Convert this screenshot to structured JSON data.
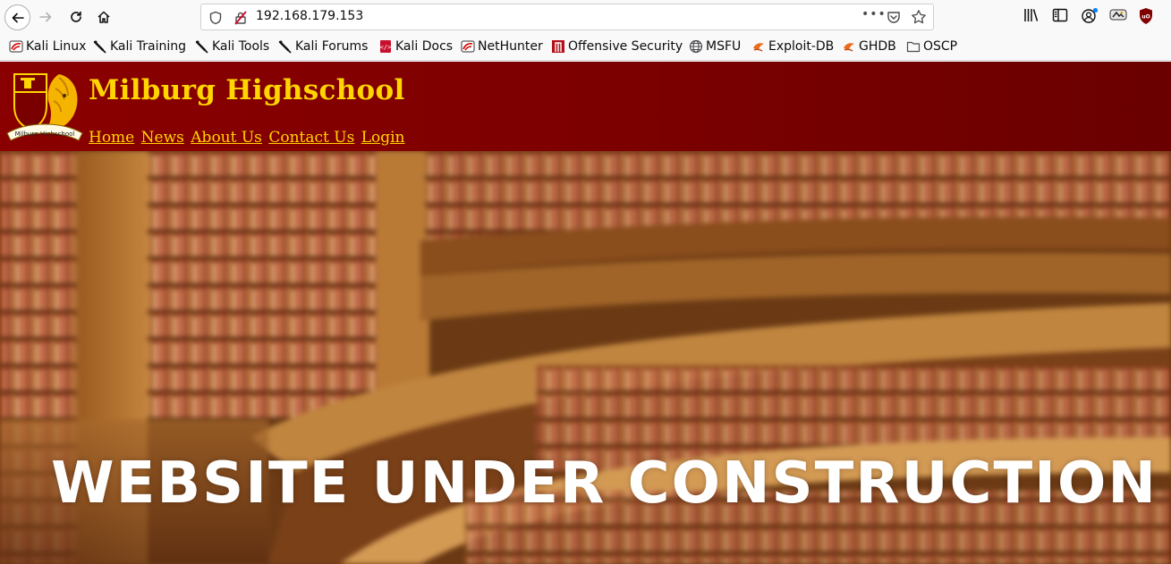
{
  "browser": {
    "url": "192.168.179.153",
    "url_actions_glyph": "•••",
    "bookmarks": [
      {
        "label": "Kali Linux",
        "icon": "kali-dragon-icon"
      },
      {
        "label": "Kali Training",
        "icon": "kali-sword-icon"
      },
      {
        "label": "Kali Tools",
        "icon": "kali-sword-icon"
      },
      {
        "label": "Kali Forums",
        "icon": "kali-sword-icon"
      },
      {
        "label": "Kali Docs",
        "icon": "docs-icon"
      },
      {
        "label": "NetHunter",
        "icon": "kali-dragon-icon"
      },
      {
        "label": "Offensive Security",
        "icon": "offsec-icon"
      },
      {
        "label": "MSFU",
        "icon": "globe-icon"
      },
      {
        "label": "Exploit-DB",
        "icon": "exploitdb-icon"
      },
      {
        "label": "GHDB",
        "icon": "exploitdb-icon"
      },
      {
        "label": "OSCP",
        "icon": "folder-icon"
      }
    ]
  },
  "site": {
    "title": "Milburg Highschool",
    "crest_banner": "Milburg Highschool",
    "nav": [
      "Home",
      "News",
      "About Us",
      "Contact Us",
      "Login"
    ],
    "hero_text": "WEBSITE UNDER CONSTRUCTION"
  },
  "colors": {
    "header_red": "#8a0000",
    "title_gold": "#ffd500",
    "hero_text": "#ffffff"
  }
}
